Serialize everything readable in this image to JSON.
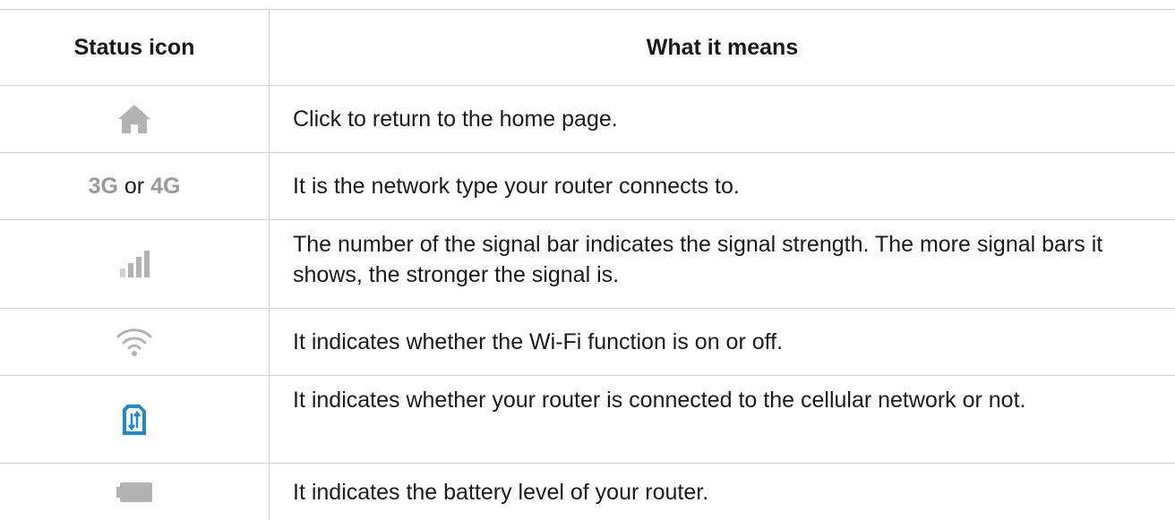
{
  "header": {
    "col1": "Status icon",
    "col2": "What it means"
  },
  "rows": [
    {
      "icon": "home-icon",
      "text": "Click to return to the home page."
    },
    {
      "icon": "network-type",
      "net_a": "3G",
      "net_or": "or",
      "net_b": "4G",
      "text": "It is the network type your router connects to."
    },
    {
      "icon": "signal-bars-icon",
      "text": "The number of the signal bar indicates the signal strength. The more signal bars it shows, the stronger the signal is."
    },
    {
      "icon": "wifi-icon",
      "text": "It indicates whether the Wi-Fi function is on or off."
    },
    {
      "icon": "cellular-data-icon",
      "text": "It indicates whether your router is connected to the cellular network or not."
    },
    {
      "icon": "battery-icon",
      "text": "It indicates the battery level of your router."
    }
  ],
  "colors": {
    "icon_gray": "#b3b3b3",
    "text_gray": "#9a9a9a",
    "accent_blue": "#1e88d2",
    "border": "#d4d4d4"
  }
}
